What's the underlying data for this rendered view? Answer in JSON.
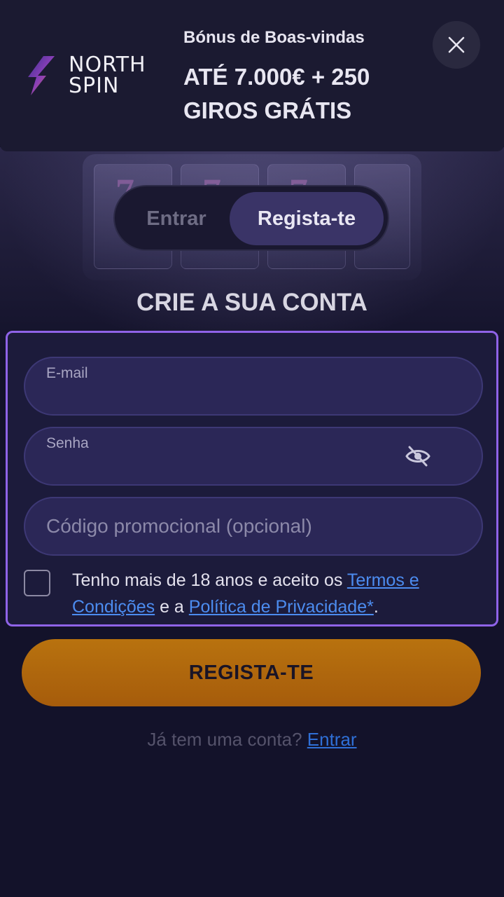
{
  "banner": {
    "logo_text_line1": "NORTH",
    "logo_text_line2": "SPIN",
    "subtitle": "Bónus de Boas-vindas",
    "title": "ATÉ 7.000€ + 250 GIROS GRÁTIS",
    "close_icon": "close-icon"
  },
  "tabs": {
    "login": "Entrar",
    "register": "Regista-te",
    "active": "register"
  },
  "heading": "CRIE A SUA CONTA",
  "form": {
    "email_label": "E-mail",
    "password_label": "Senha",
    "password_icon": "eye-slash-icon",
    "promo_placeholder": "Código promocional (opcional)",
    "terms_prefix": "Tenho mais de 18 anos e aceito os ",
    "terms_link": "Termos e Condições",
    "terms_middle": " e a ",
    "privacy_link": "Política de Privacidade*",
    "terms_suffix": ".",
    "terms_checked": false
  },
  "cta_label": "REGISTA-TE",
  "footer": {
    "question": "Já tem uma conta? ",
    "login_link": "Entrar"
  },
  "colors": {
    "accent": "#8f63e8",
    "cta": "#b8720e",
    "link": "#4c8cf0",
    "background": "#13122a"
  }
}
